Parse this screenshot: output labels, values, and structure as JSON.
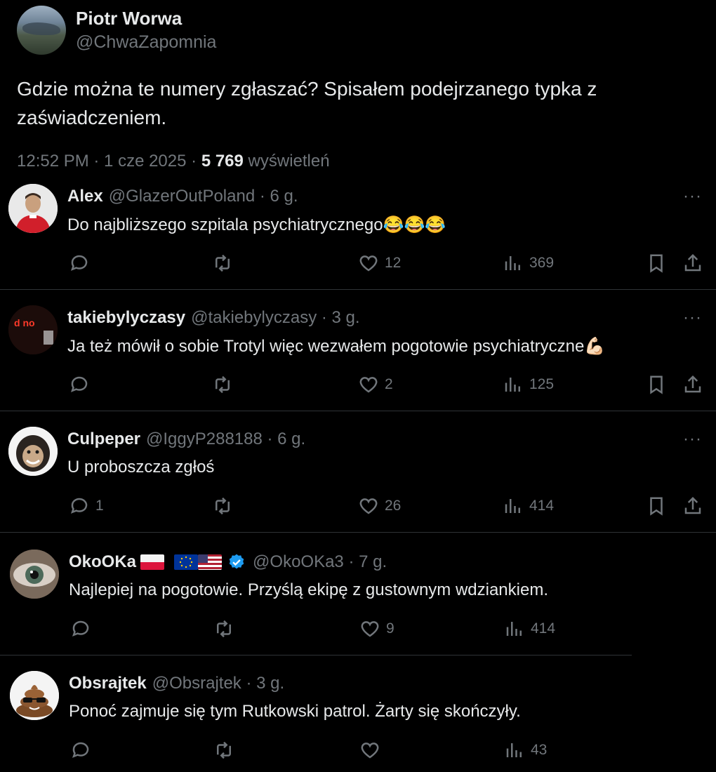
{
  "main_tweet": {
    "name": "Piotr Worwa",
    "handle": "@ChwaZapomnia",
    "text": "Gdzie można te numery zgłaszać? Spisałem podejrzanego typka z zaświadczeniem.",
    "time": "12:52 PM · 1 cze 2025 · ",
    "views": "5 769",
    "views_label": " wyświetleń"
  },
  "replies": [
    {
      "name": "Alex",
      "handle": "@GlazerOutPoland · 6 g.",
      "text": "Do najbliższego szpitala psychiatrycznego😂😂😂",
      "reply_count": "",
      "retweet_count": "",
      "like_count": "12",
      "view_count": "369",
      "more": "···"
    },
    {
      "name": "takiebylyczasy",
      "handle": "@takiebylyczasy · 3 g.",
      "text": "Ja też mówił o sobie Trotyl więc wezwałem pogotowie psychiatryczne💪🏻",
      "reply_count": "",
      "retweet_count": "",
      "like_count": "2",
      "view_count": "125",
      "more": "···"
    },
    {
      "name": "Culpeper",
      "handle": "@IggyP288188 · 6 g.",
      "text": "U proboszcza zgłoś",
      "reply_count": "1",
      "retweet_count": "",
      "like_count": "26",
      "view_count": "414",
      "more": "···"
    },
    {
      "name": "OkoOKa",
      "handle": "@OkoOKa3 · 7 g.",
      "text": "Najlepiej na pogotowie. Przyślą ekipę z gustownym wdziankiem.",
      "reply_count": "",
      "retweet_count": "",
      "like_count": "9",
      "view_count": "414",
      "more": ""
    },
    {
      "name": "Obsrajtek",
      "handle": "@Obsrajtek · 3 g.",
      "text": "Ponoć zajmuje się tym Rutkowski patrol. Żarty się skończyły.",
      "reply_count": "",
      "retweet_count": "",
      "like_count": "",
      "view_count": "43",
      "more": ""
    }
  ],
  "avatar_art": {
    "reply_2_sign": "d no"
  },
  "colors": {
    "background": "#000000",
    "text": "#e7e9ea",
    "muted": "#71767b",
    "divider": "#2f3336",
    "verified": "#1d9bf0"
  }
}
